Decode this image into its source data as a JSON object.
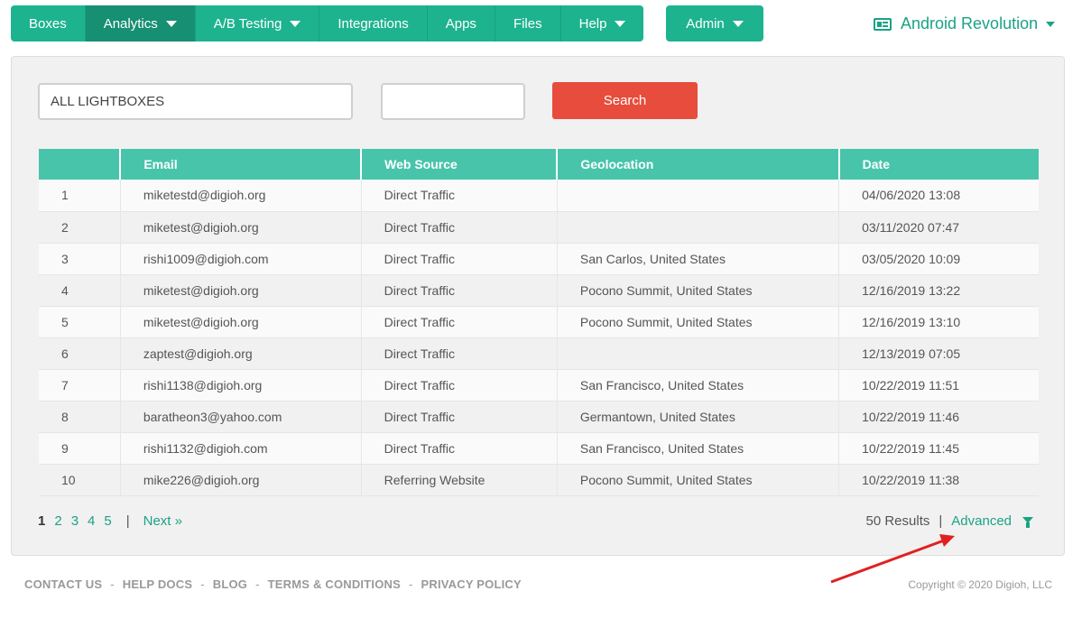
{
  "nav": {
    "items": [
      {
        "label": "Boxes",
        "dropdown": false,
        "active": false
      },
      {
        "label": "Analytics",
        "dropdown": true,
        "active": true
      },
      {
        "label": "A/B Testing",
        "dropdown": true,
        "active": false
      },
      {
        "label": "Integrations",
        "dropdown": false,
        "active": false
      },
      {
        "label": "Apps",
        "dropdown": false,
        "active": false
      },
      {
        "label": "Files",
        "dropdown": false,
        "active": false
      },
      {
        "label": "Help",
        "dropdown": true,
        "active": false
      }
    ],
    "admin_label": "Admin",
    "account_label": "Android Revolution"
  },
  "filters": {
    "lightbox_select_value": "ALL LIGHTBOXES",
    "search_input_value": "",
    "search_button_label": "Search"
  },
  "table": {
    "headers": [
      "",
      "Email",
      "Web Source",
      "Geolocation",
      "Date"
    ],
    "rows": [
      [
        "1",
        "miketestd@digioh.org",
        "Direct Traffic",
        "",
        "04/06/2020 13:08"
      ],
      [
        "2",
        "miketest@digioh.org",
        "Direct Traffic",
        "",
        "03/11/2020 07:47"
      ],
      [
        "3",
        "rishi1009@digioh.com",
        "Direct Traffic",
        "San Carlos, United States",
        "03/05/2020 10:09"
      ],
      [
        "4",
        "miketest@digioh.org",
        "Direct Traffic",
        "Pocono Summit, United States",
        "12/16/2019 13:22"
      ],
      [
        "5",
        "miketest@digioh.org",
        "Direct Traffic",
        "Pocono Summit, United States",
        "12/16/2019 13:10"
      ],
      [
        "6",
        "zaptest@digioh.org",
        "Direct Traffic",
        "",
        "12/13/2019 07:05"
      ],
      [
        "7",
        "rishi1138@digioh.org",
        "Direct Traffic",
        "San Francisco, United States",
        "10/22/2019 11:51"
      ],
      [
        "8",
        "baratheon3@yahoo.com",
        "Direct Traffic",
        "Germantown, United States",
        "10/22/2019 11:46"
      ],
      [
        "9",
        "rishi1132@digioh.com",
        "Direct Traffic",
        "San Francisco, United States",
        "10/22/2019 11:45"
      ],
      [
        "10",
        "mike226@digioh.org",
        "Referring Website",
        "Pocono Summit, United States",
        "10/22/2019 11:38"
      ]
    ]
  },
  "pagination": {
    "pages": [
      "1",
      "2",
      "3",
      "4",
      "5"
    ],
    "current": "1",
    "separator": "|",
    "next_label": "Next »"
  },
  "results": {
    "count_label": "50 Results",
    "separator": "|",
    "advanced_label": "Advanced",
    "filter_icon": "funnel-icon"
  },
  "footer": {
    "links": [
      "CONTACT US",
      "HELP DOCS",
      "BLOG",
      "TERMS & CONDITIONS",
      "PRIVACY POLICY"
    ],
    "separator": "-",
    "copyright": "Copyright © 2020 Digioh, LLC"
  },
  "colors": {
    "brand_green": "#1eb38f",
    "table_header": "#48c4ab",
    "search_red": "#e74c3c",
    "annotation_arrow": "#e02020"
  }
}
